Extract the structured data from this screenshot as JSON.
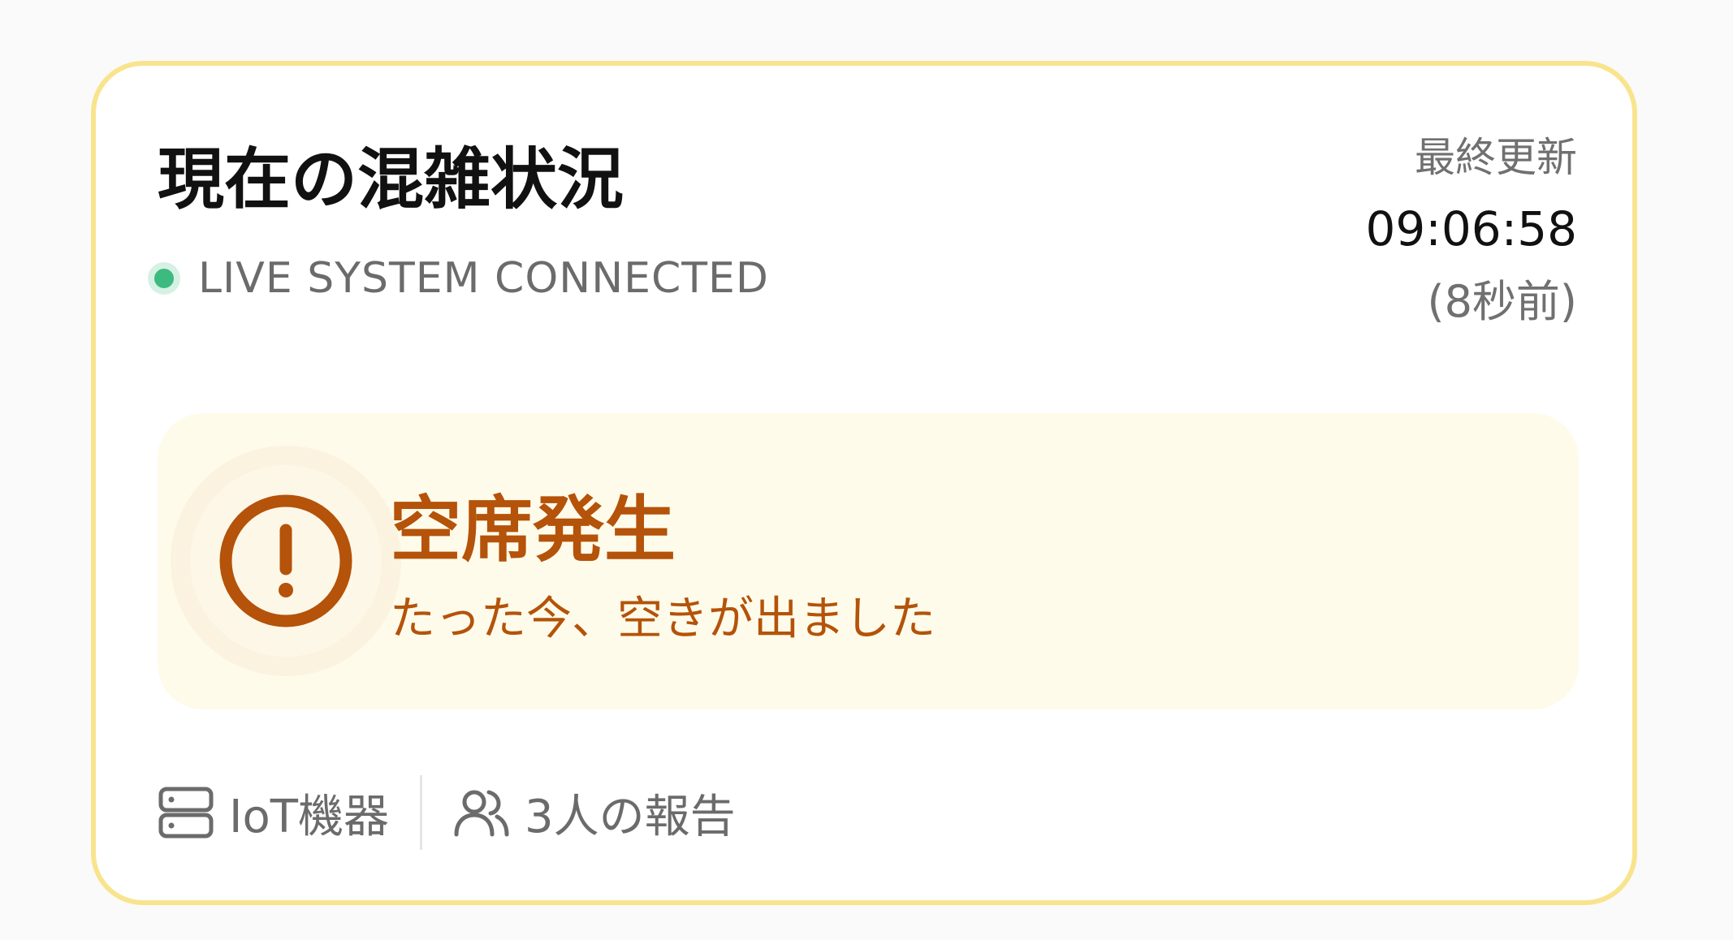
{
  "card": {
    "title": "現在の混雑状況",
    "live_status": "LIVE SYSTEM CONNECTED",
    "last_update": {
      "label": "最終更新",
      "time": "09:06:58",
      "ago": "(8秒前)"
    }
  },
  "alert": {
    "title": "空席発生",
    "subtitle": "たった今、空きが出ました",
    "icon": "alert-circle-icon"
  },
  "footer": {
    "sources": [
      {
        "icon": "server-icon",
        "label": "IoT機器"
      },
      {
        "icon": "users-icon",
        "label": "3人の報告"
      }
    ]
  },
  "colors": {
    "card_border": "#f9e48e",
    "live_indicator": "#3dba7f",
    "alert_background": "#fefbeb",
    "alert_accent": "#b45309"
  }
}
